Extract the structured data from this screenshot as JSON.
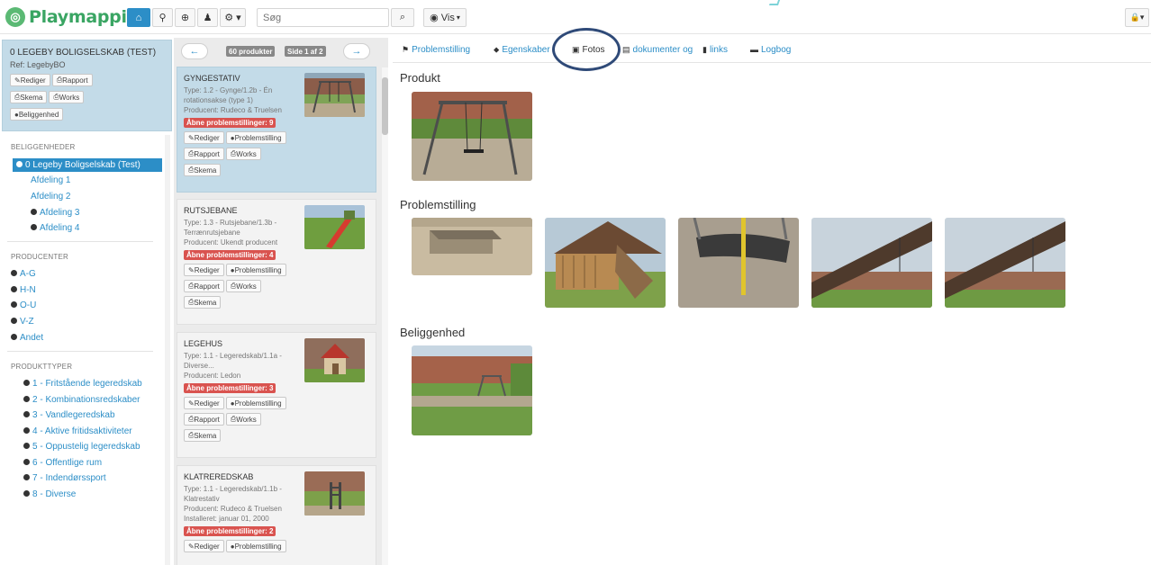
{
  "navbar": {
    "logo_text": "Playmapping",
    "search_placeholder": "Søg",
    "vis_label": "Vis",
    "home_glyph": "⌂",
    "pin_glyph": "⚲",
    "zoom_glyph": "⊕",
    "user_glyph": "♟",
    "settings_glyph": "⚙ ▾",
    "search_glyph": "⌕",
    "lock_glyph": "🔒▾",
    "eye_glyph": "◉"
  },
  "location": {
    "title": "0 LEGEBY BOLIGSELSKAB (TEST)",
    "ref": "Ref: LegebyBO",
    "buttons": [
      "Rediger",
      "Rapport",
      "Skema",
      "Works",
      "Beliggenhed"
    ]
  },
  "sidebar": {
    "beliggenheder_heading": "BELIGGENHEDER",
    "beliggenheder": [
      {
        "label": "0 Legeby Boligselskab (Test)",
        "selected": true,
        "dot": true
      },
      {
        "label": "Afdeling 1",
        "dot": false
      },
      {
        "label": "Afdeling 2",
        "dot": false
      },
      {
        "label": "Afdeling 3",
        "dot": true
      },
      {
        "label": "Afdeling 4",
        "dot": true
      }
    ],
    "producenter_heading": "PRODUCENTER",
    "producenter": [
      "A-G",
      "H-N",
      "O-U",
      "V-Z",
      "Andet"
    ],
    "produkttyper_heading": "PRODUKTTYPER",
    "produkttyper": [
      "1 - Fritstående legeredskab",
      "2 - Kombinationsredskaber",
      "3 - Vandlegeredskab",
      "4 - Aktive fritidsaktiviteter",
      "5 - Oppustelig legeredskab",
      "6 - Offentlige rum",
      "7 - Indendørssport",
      "8 - Diverse"
    ]
  },
  "pager": {
    "count": "60 produkter",
    "page": "Side 1 af 2",
    "prev": "←",
    "next": "→"
  },
  "products": [
    {
      "title": "GYNGESTATIV",
      "type": "Type: 1.2 - Gynge/1.2b - Én rotationsakse (type 1)",
      "producent": "Producent: Rudeco & Truelsen",
      "installeret": "",
      "issues": "Åbne problemstillinger: 9",
      "buttons": [
        "Rediger",
        "Problemstilling",
        "Rapport",
        "Works",
        "Skema"
      ]
    },
    {
      "title": "RUTSJEBANE",
      "type": "Type: 1.3 - Rutsjebane/1.3b - Terrænrutsjebane",
      "producent": "Producent: Ukendt producent",
      "installeret": "",
      "issues": "Åbne problemstillinger: 4",
      "buttons": [
        "Rediger",
        "Problemstilling",
        "Rapport",
        "Works",
        "Skema"
      ]
    },
    {
      "title": "LEGEHUS",
      "type": "Type: 1.1 - Legeredskab/1.1a - Diverse...",
      "producent": "Producent: Ledon",
      "installeret": "",
      "issues": "Åbne problemstillinger: 3",
      "buttons": [
        "Rediger",
        "Problemstilling",
        "Rapport",
        "Works",
        "Skema"
      ]
    },
    {
      "title": "KLATREREDSKAB",
      "type": "Type: 1.1 - Legeredskab/1.1b - Klatrestativ",
      "producent": "Producent: Rudeco & Truelsen",
      "installeret": "Installeret: januar 01, 2000",
      "issues": "Åbne problemstillinger: 2",
      "buttons": [
        "Rediger",
        "Problemstilling"
      ]
    }
  ],
  "tabs": [
    {
      "label": "Problemstilling",
      "icon": "⚑"
    },
    {
      "label": "Egenskaber",
      "icon": "⬥"
    },
    {
      "label": "Fotos",
      "icon": "▣"
    },
    {
      "label": "dokumenter og",
      "icon": "▤"
    },
    {
      "label": "links",
      "icon": "▮"
    },
    {
      "label": "Logbog",
      "icon": "▬"
    }
  ],
  "sections": {
    "produkt": "Produkt",
    "problemstilling": "Problemstilling",
    "beliggenhed": "Beliggenhed"
  },
  "colors": {
    "accent": "#2c8ec7",
    "selected_bg": "#c3dbe8",
    "danger": "#d9534f",
    "brand_green": "#3aa563",
    "highlight_circle": "#2f4a78"
  }
}
